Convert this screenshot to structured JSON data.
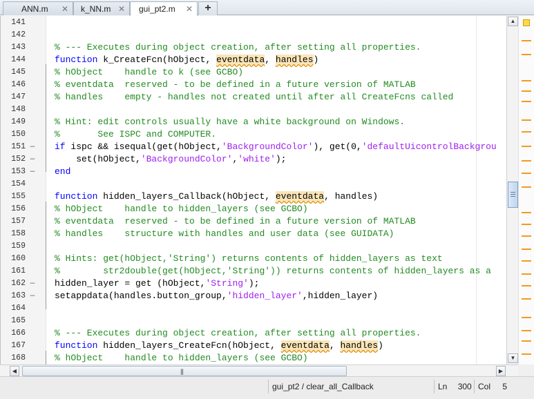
{
  "tabs": [
    {
      "label": "ANN.m",
      "active": false
    },
    {
      "label": "k_NN.m",
      "active": false
    },
    {
      "label": "gui_pt2.m",
      "active": true
    }
  ],
  "add_tab_label": "+",
  "close_glyph": "✕",
  "code_lines": [
    {
      "n": "141",
      "fold": "",
      "segs": []
    },
    {
      "n": "142",
      "fold": "",
      "segs": []
    },
    {
      "n": "143",
      "fold": "",
      "segs": [
        {
          "t": "% --- Executes during object creation, after setting all properties.",
          "c": "cmt"
        }
      ]
    },
    {
      "n": "144",
      "fold": "",
      "segs": [
        {
          "t": "function",
          "c": "kw"
        },
        {
          "t": " k_CreateFcn(hObject, ",
          "c": ""
        },
        {
          "t": "eventdata",
          "c": "hl"
        },
        {
          "t": ", ",
          "c": ""
        },
        {
          "t": "handles",
          "c": "hl"
        },
        {
          "t": ")",
          "c": ""
        }
      ]
    },
    {
      "n": "145",
      "fold": "",
      "segs": [
        {
          "t": "% hObject    handle to k (see GCBO)",
          "c": "cmt"
        }
      ]
    },
    {
      "n": "146",
      "fold": "",
      "segs": [
        {
          "t": "% eventdata  reserved - to be defined in a future version of MATLAB",
          "c": "cmt"
        }
      ]
    },
    {
      "n": "147",
      "fold": "",
      "segs": [
        {
          "t": "% handles    empty - handles not created until after all CreateFcns called",
          "c": "cmt"
        }
      ]
    },
    {
      "n": "148",
      "fold": "",
      "segs": []
    },
    {
      "n": "149",
      "fold": "",
      "segs": [
        {
          "t": "% Hint: edit controls usually have a white background on Windows.",
          "c": "cmt"
        }
      ]
    },
    {
      "n": "150",
      "fold": "",
      "segs": [
        {
          "t": "%       See ISPC and COMPUTER.",
          "c": "cmt"
        }
      ]
    },
    {
      "n": "151",
      "fold": "—",
      "segs": [
        {
          "t": "if",
          "c": "kw"
        },
        {
          "t": " ispc && isequal(get(hObject,",
          "c": ""
        },
        {
          "t": "'BackgroundColor'",
          "c": "str"
        },
        {
          "t": "), get(0,",
          "c": ""
        },
        {
          "t": "'defaultUicontrolBackgrou",
          "c": "str"
        }
      ]
    },
    {
      "n": "152",
      "fold": "—",
      "segs": [
        {
          "t": "    set(hObject,",
          "c": ""
        },
        {
          "t": "'BackgroundColor'",
          "c": "str"
        },
        {
          "t": ",",
          "c": ""
        },
        {
          "t": "'white'",
          "c": "str"
        },
        {
          "t": ");",
          "c": ""
        }
      ]
    },
    {
      "n": "153",
      "fold": "—",
      "segs": [
        {
          "t": "end",
          "c": "kw"
        }
      ]
    },
    {
      "n": "154",
      "fold": "",
      "segs": []
    },
    {
      "n": "155",
      "fold": "",
      "segs": [
        {
          "t": "function",
          "c": "kw"
        },
        {
          "t": " hidden_layers_Callback(hObject, ",
          "c": ""
        },
        {
          "t": "eventdata",
          "c": "hl"
        },
        {
          "t": ", handles)",
          "c": ""
        }
      ]
    },
    {
      "n": "156",
      "fold": "",
      "segs": [
        {
          "t": "% hObject    handle to hidden_layers (see GCBO)",
          "c": "cmt"
        }
      ]
    },
    {
      "n": "157",
      "fold": "",
      "segs": [
        {
          "t": "% eventdata  reserved - to be defined in a future version of MATLAB",
          "c": "cmt"
        }
      ]
    },
    {
      "n": "158",
      "fold": "",
      "segs": [
        {
          "t": "% handles    structure with handles and user data (see GUIDATA)",
          "c": "cmt"
        }
      ]
    },
    {
      "n": "159",
      "fold": "",
      "segs": []
    },
    {
      "n": "160",
      "fold": "",
      "segs": [
        {
          "t": "% Hints: get(hObject,'String') returns contents of hidden_layers as text",
          "c": "cmt"
        }
      ]
    },
    {
      "n": "161",
      "fold": "",
      "segs": [
        {
          "t": "%        str2double(get(hObject,'String')) returns contents of hidden_layers as a",
          "c": "cmt"
        }
      ]
    },
    {
      "n": "162",
      "fold": "—",
      "segs": [
        {
          "t": "hidden_layer = get (hObject,",
          "c": ""
        },
        {
          "t": "'String'",
          "c": "str"
        },
        {
          "t": ");",
          "c": ""
        }
      ]
    },
    {
      "n": "163",
      "fold": "—",
      "segs": [
        {
          "t": "setappdata(handles.button_group,",
          "c": ""
        },
        {
          "t": "'hidden_layer'",
          "c": "str"
        },
        {
          "t": ",hidden_layer)",
          "c": ""
        }
      ]
    },
    {
      "n": "164",
      "fold": "",
      "segs": []
    },
    {
      "n": "165",
      "fold": "",
      "segs": []
    },
    {
      "n": "166",
      "fold": "",
      "segs": [
        {
          "t": "% --- Executes during object creation, after setting all properties.",
          "c": "cmt"
        }
      ]
    },
    {
      "n": "167",
      "fold": "",
      "segs": [
        {
          "t": "function",
          "c": "kw"
        },
        {
          "t": " hidden_layers_CreateFcn(hObject, ",
          "c": ""
        },
        {
          "t": "eventdata",
          "c": "hl"
        },
        {
          "t": ", ",
          "c": ""
        },
        {
          "t": "handles",
          "c": "hl"
        },
        {
          "t": ")",
          "c": ""
        }
      ]
    },
    {
      "n": "168",
      "fold": "",
      "segs": [
        {
          "t": "% hObject    handle to hidden_layers (see GCBO)",
          "c": "cmt"
        }
      ]
    }
  ],
  "scroll_arrows": {
    "up": "▲",
    "down": "▼",
    "left": "◀",
    "right": "▶"
  },
  "hscroll_grip": "|||",
  "marker_colors": {
    "warning": "#f29a1f",
    "status": "#ffd84a"
  },
  "status": {
    "function_path": "gui_pt2 / clear_all_Callback",
    "ln_label": "Ln",
    "ln_value": "300",
    "col_label": "Col",
    "col_value": "5"
  }
}
